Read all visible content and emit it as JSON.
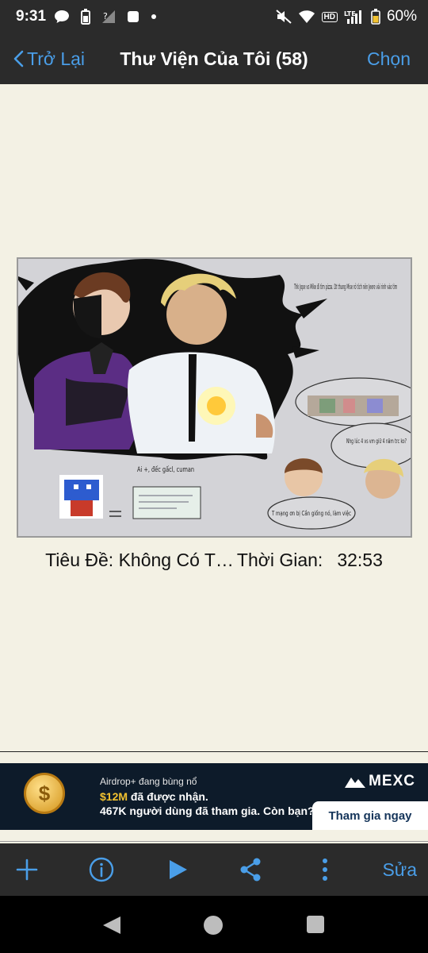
{
  "status_bar": {
    "time": "9:31",
    "battery": "60%",
    "network": "LTE"
  },
  "nav": {
    "back_label": "Trở Lại",
    "title": "Thư Viện Của Tôi (58)",
    "select_label": "Chọn"
  },
  "artwork": {
    "note_top": "Thk Jope vs Mike đi tìm pizza. Dt thung Mise rỏ tích nên Jeere vài rinh vào tìm",
    "note_right": "Nhg lúc 4 vs vm giữ 4 năm trc ko?",
    "note_bottom": "T mạng ơn bị Cần giống nó, làm việc",
    "note_left": "Ai +, đếc gấcl, cuman"
  },
  "caption": {
    "title_label": "Tiêu Đề: Không Có T…",
    "time_label": "Thời Gian:",
    "time_value": "32:53"
  },
  "ad": {
    "line1": "Airdrop+ đang bùng nổ",
    "line2_highlight": "$12M",
    "line2_rest": " đã được nhận.",
    "line3": "467K người dùng đã tham gia. Còn bạn?",
    "brand": "MEXC",
    "cta": "Tham gia ngay"
  },
  "toolbar": {
    "edit_label": "Sửa"
  },
  "colors": {
    "accent": "#4a9ee8",
    "bar": "#2b2b2b",
    "background": "#f3f1e4"
  }
}
